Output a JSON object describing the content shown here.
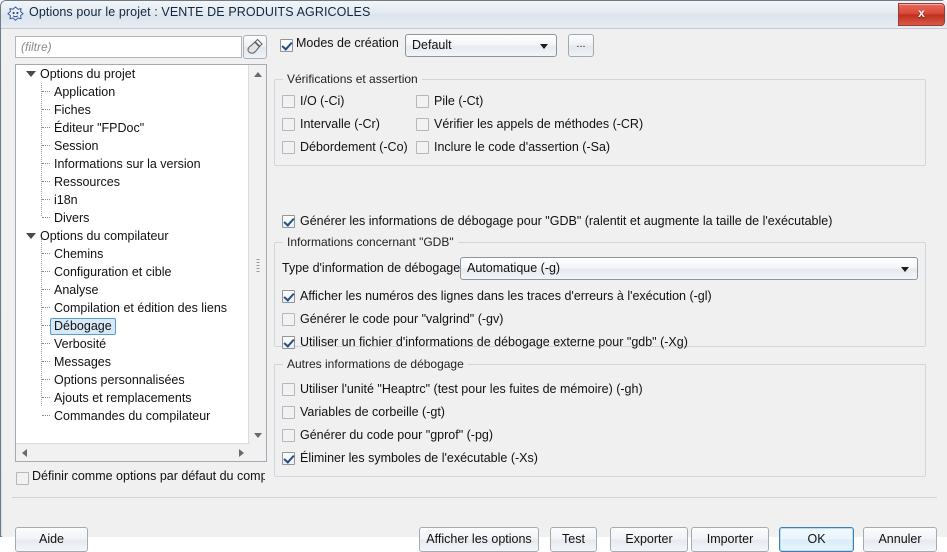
{
  "window": {
    "title": "Options pour le projet : VENTE DE PRODUITS AGRICOLES",
    "icon": "lazarus-app-icon",
    "close_label": "x"
  },
  "toolbar": {
    "filter_placeholder": "(filtre)",
    "filter_value": "",
    "filter_clear_icon": "brush-clear-icon",
    "modes_checkbox_label": "Modes de création",
    "modes_checked": true,
    "modes_combo_value": "Default",
    "modes_ellipsis_label": "..."
  },
  "tree": {
    "items": [
      {
        "label": "Options du projet",
        "level": 0,
        "expanded": true,
        "selected": false
      },
      {
        "label": "Application",
        "level": 1,
        "selected": false
      },
      {
        "label": "Fiches",
        "level": 1,
        "selected": false
      },
      {
        "label": "Éditeur \"FPDoc\"",
        "level": 1,
        "selected": false
      },
      {
        "label": "Session",
        "level": 1,
        "selected": false
      },
      {
        "label": "Informations sur la version",
        "level": 1,
        "selected": false
      },
      {
        "label": "Ressources",
        "level": 1,
        "selected": false
      },
      {
        "label": "i18n",
        "level": 1,
        "selected": false
      },
      {
        "label": "Divers",
        "level": 1,
        "selected": false
      },
      {
        "label": "Options du compilateur",
        "level": 0,
        "expanded": true,
        "selected": false
      },
      {
        "label": "Chemins",
        "level": 1,
        "selected": false
      },
      {
        "label": "Configuration et cible",
        "level": 1,
        "selected": false
      },
      {
        "label": "Analyse",
        "level": 1,
        "selected": false
      },
      {
        "label": "Compilation et édition des liens",
        "level": 1,
        "selected": false
      },
      {
        "label": "Débogage",
        "level": 1,
        "selected": true
      },
      {
        "label": "Verbosité",
        "level": 1,
        "selected": false
      },
      {
        "label": "Messages",
        "level": 1,
        "selected": false
      },
      {
        "label": "Options personnalisées",
        "level": 1,
        "selected": false
      },
      {
        "label": "Ajouts et remplacements",
        "level": 1,
        "selected": false
      },
      {
        "label": "Commandes du compilateur",
        "level": 1,
        "selected": false
      }
    ]
  },
  "default_options": {
    "label": "Définir comme options par défaut du comp",
    "checked": false
  },
  "groups": {
    "verifications": {
      "legend": "Vérifications et assertion",
      "col1": [
        {
          "label": "I/O (-Ci)",
          "checked": false
        },
        {
          "label": "Intervalle (-Cr)",
          "checked": false
        },
        {
          "label": "Débordement (-Co)",
          "checked": false
        }
      ],
      "col2": [
        {
          "label": "Pile (-Ct)",
          "checked": false
        },
        {
          "label": "Vérifier les appels de méthodes (-CR)",
          "checked": false
        },
        {
          "label": "Inclure le code d'assertion (-Sa)",
          "checked": false
        }
      ]
    },
    "generate_debug": {
      "label": "Générer les informations de débogage pour \"GDB\" (ralentit et augmente la taille de l'exécutable)",
      "checked": true
    },
    "gdb": {
      "legend": "Informations concernant \"GDB\"",
      "type_label": "Type d'information de débogage",
      "type_value": "Automatique (-g)",
      "options": [
        {
          "label": "Afficher les numéros des lignes dans les traces d'erreurs à l'exécution (-gl)",
          "checked": true
        },
        {
          "label": "Générer le code pour \"valgrind\" (-gv)",
          "checked": false
        },
        {
          "label": "Utiliser un fichier d'informations de débogage externe pour \"gdb\" (-Xg)",
          "checked": true
        }
      ]
    },
    "autres": {
      "legend": "Autres informations de débogage",
      "options": [
        {
          "label": "Utiliser l'unité \"Heaptrc\" (test pour les fuites de mémoire) (-gh)",
          "checked": false
        },
        {
          "label": "Variables de corbeille (-gt)",
          "checked": false
        },
        {
          "label": "Générer du code pour \"gprof\" (-pg)",
          "checked": false
        },
        {
          "label": "Éliminer les symboles de l'exécutable (-Xs)",
          "checked": true
        }
      ]
    }
  },
  "buttons": {
    "aide": "Aide",
    "afficher_options": "Afficher les options",
    "test": "Test",
    "exporter": "Exporter",
    "importer": "Importer",
    "ok": "OK",
    "annuler": "Annuler"
  },
  "colors": {
    "selection_fill": "#d7e8f7",
    "selection_border": "#5c9ccc",
    "default_button_border": "#3c7fb1",
    "close_button": "#bf2f1f",
    "dialog_bg": "#f0f0f0"
  }
}
